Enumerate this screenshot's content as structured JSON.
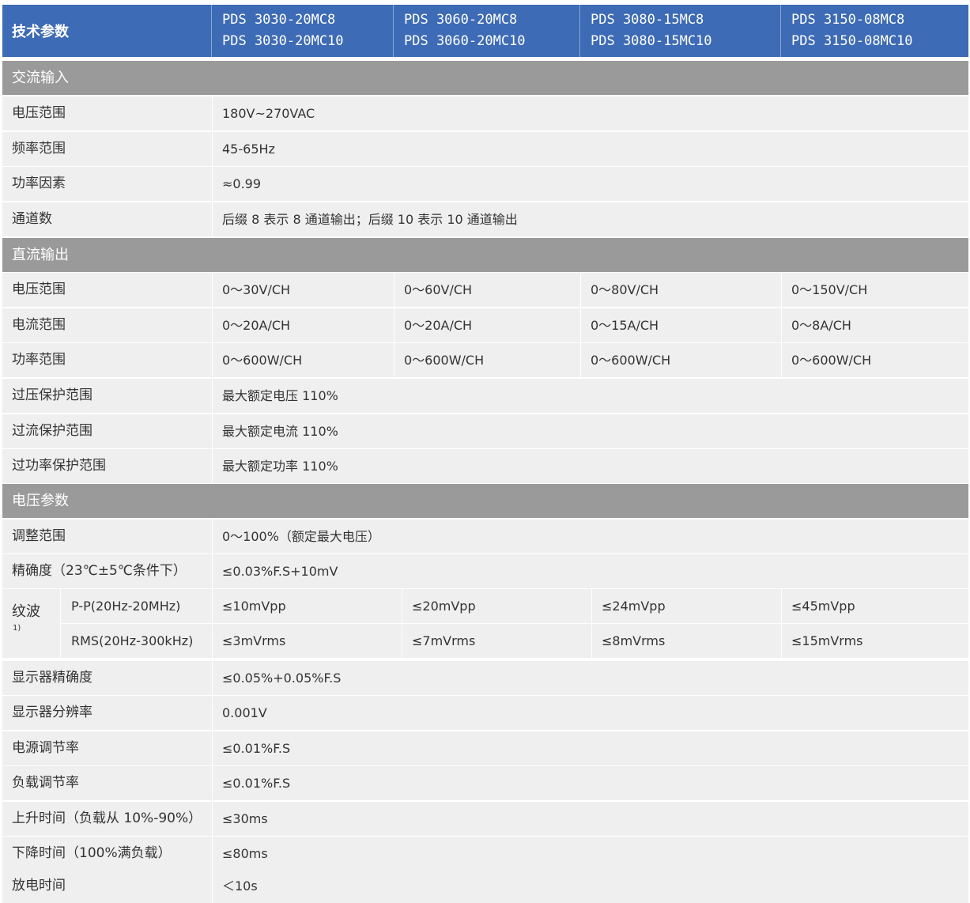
{
  "header": {
    "param_label": "技术参数",
    "models": [
      {
        "line1": "PDS 3030-20MC8",
        "line2": "PDS 3030-20MC10"
      },
      {
        "line1": "PDS 3060-20MC8",
        "line2": "PDS 3060-20MC10"
      },
      {
        "line1": "PDS 3080-15MC8",
        "line2": "PDS 3080-15MC10"
      },
      {
        "line1": "PDS 3150-08MC8",
        "line2": "PDS 3150-08MC10"
      }
    ]
  },
  "ac_input": {
    "title": "交流输入",
    "rows": [
      {
        "label": "电压范围",
        "value": "180V~270VAC"
      },
      {
        "label": "频率范围",
        "value": "45-65Hz"
      },
      {
        "label": "功率因素",
        "value": "≈0.99"
      },
      {
        "label": "通道数",
        "value": "后缀 8 表示 8 通道输出；后缀 10 表示 10 通道输出"
      }
    ]
  },
  "dc_output": {
    "title": "直流输出",
    "voltage": {
      "label": "电压范围",
      "values": [
        "0～30V/CH",
        "0～60V/CH",
        "0～80V/CH",
        "0～150V/CH"
      ]
    },
    "current": {
      "label": "电流范围",
      "values": [
        "0～20A/CH",
        "0～20A/CH",
        "0～15A/CH",
        "0～8A/CH"
      ]
    },
    "power": {
      "label": "功率范围",
      "values": [
        "0～600W/CH",
        "0～600W/CH",
        "0～600W/CH",
        "0～600W/CH"
      ]
    },
    "ovp": {
      "label": "过压保护范围",
      "value": "最大额定电压 110%"
    },
    "ocp": {
      "label": "过流保护范围",
      "value": "最大额定电流 110%"
    },
    "opp": {
      "label": "过功率保护范围",
      "value": "最大额定功率 110%"
    }
  },
  "voltage_params": {
    "title": "电压参数",
    "adjust": {
      "label": "调整范围",
      "value": "0～100%（额定最大电压）"
    },
    "accuracy": {
      "label": "精确度（23℃±5℃条件下）",
      "value": "≤0.03%F.S+10mV"
    },
    "ripple": {
      "label": "纹波",
      "note": "1)",
      "pp": {
        "label": "P-P(20Hz-20MHz)",
        "values": [
          "≤10mVpp",
          "≤20mVpp",
          "≤24mVpp",
          "≤45mVpp"
        ]
      },
      "rms": {
        "label": "RMS(20Hz-300kHz)",
        "values": [
          "≤3mVrms",
          "≤7mVrms",
          "≤8mVrms",
          "≤15mVrms"
        ]
      }
    },
    "display_accuracy": {
      "label": "显示器精确度",
      "value": "≤0.05%+0.05%F.S"
    },
    "display_resolution": {
      "label": "显示器分辨率",
      "value": "0.001V"
    },
    "line_regulation": {
      "label": "电源调节率",
      "value": "≤0.01%F.S"
    },
    "load_regulation": {
      "label": "负载调节率",
      "value": "≤0.01%F.S"
    },
    "rise_time": {
      "label": "上升时间（负载从 10%-90%）",
      "value": "≤30ms"
    },
    "fall_time": {
      "label": "下降时间（100%满负载）",
      "value": "≤80ms"
    },
    "discharge_time": {
      "label": "放电时间",
      "value": "＜10s"
    }
  },
  "colors": {
    "header_bg": "#3d6bb5",
    "section_bg": "#9a9a9a",
    "row_bg": "#efefef",
    "text": "#333333"
  }
}
